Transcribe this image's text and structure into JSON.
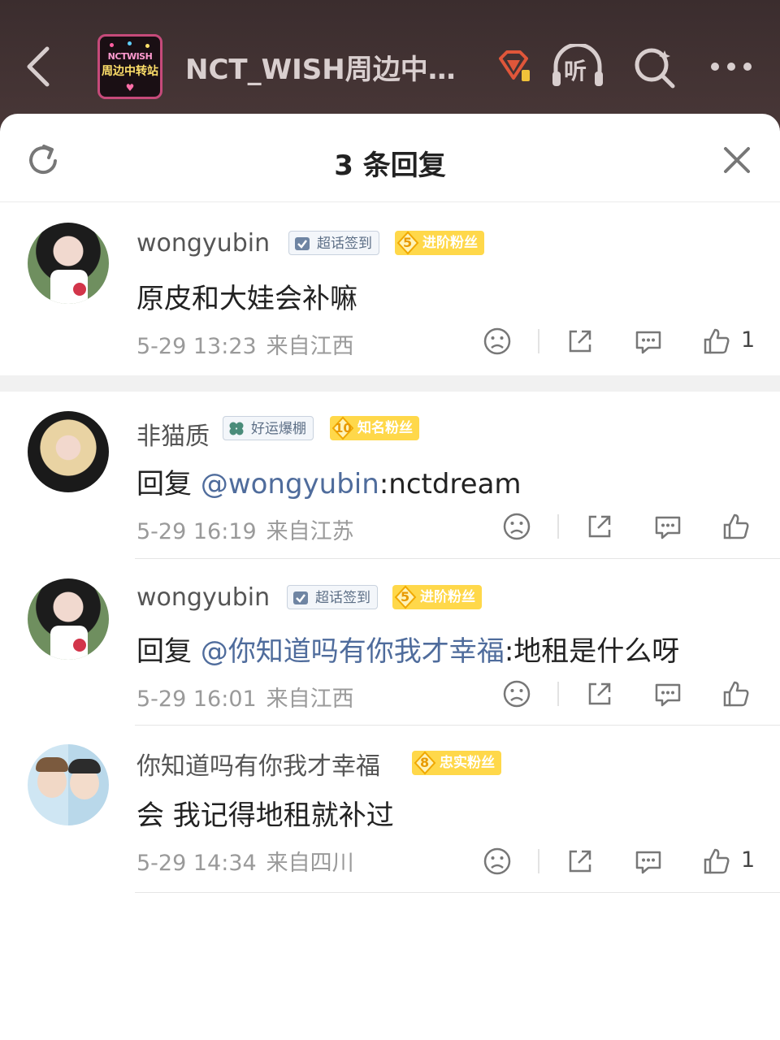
{
  "header": {
    "title": "NCT_WISH周边中…",
    "logo_text": [
      "NCTWISH",
      "周边中转站"
    ],
    "listen_label": "听"
  },
  "sheet": {
    "title": "3 条回复"
  },
  "comments": [
    {
      "user": "wongyubin",
      "sign_badge": "超话签到",
      "fan_level": "5",
      "fan_badge": "进阶粉丝",
      "text_plain": "原皮和大娃会补嘛",
      "time": "5-29 13:23",
      "location": "来自江西",
      "likes": "1"
    },
    {
      "user": "非猫质",
      "sign_badge": "好运爆棚",
      "fan_level": "10",
      "fan_badge": "知名粉丝",
      "reply_prefix": "回复 ",
      "mention": "@wongyubin",
      "reply_text": ":nctdream",
      "time": "5-29 16:19",
      "location": "来自江苏",
      "likes": ""
    },
    {
      "user": "wongyubin",
      "sign_badge": "超话签到",
      "fan_level": "5",
      "fan_badge": "进阶粉丝",
      "reply_prefix": "回复 ",
      "mention": "@你知道吗有你我才幸福",
      "reply_text": ":地租是什么呀",
      "time": "5-29 16:01",
      "location": "来自江西",
      "likes": ""
    },
    {
      "user": "你知道吗有你我才幸福",
      "fan_level": "8",
      "fan_badge": "忠实粉丝",
      "text_plain": "会 我记得地租就补过",
      "time": "5-29 14:34",
      "location": "来自四川",
      "likes": "1"
    }
  ],
  "colors": {
    "mention": "#4f6c9c",
    "fan_badge": "#ffd84a",
    "header_bg": "#3b2d2e"
  }
}
